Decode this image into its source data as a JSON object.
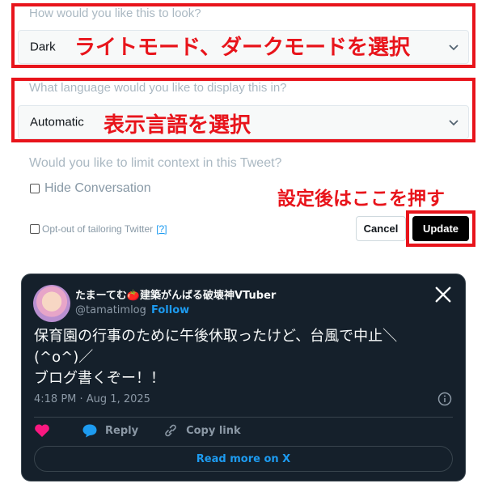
{
  "settings": {
    "look": {
      "label": "How would you like this to look?",
      "value": "Dark",
      "annotation": "ライトモード、ダークモードを選択"
    },
    "language": {
      "label": "What language would you like to display this in?",
      "value": "Automatic",
      "annotation": "表示言語を選択"
    },
    "context": {
      "label": "Would you like to limit context in this Tweet?",
      "hide_conversation": "Hide Conversation"
    },
    "opt_out": {
      "label": "Opt-out of tailoring Twitter",
      "help": "[?]"
    },
    "buttons": {
      "cancel": "Cancel",
      "update": "Update",
      "annotation": "設定後はここを押す"
    }
  },
  "tweet": {
    "author_name": "たまーてむ🍅建築がんばる破壊神VTuber",
    "handle": "@tamatimlog",
    "separator": "·",
    "follow": "Follow",
    "text_lines": [
      "保育園の行事のために午後休取ったけど、台風で中止＼",
      "(^o^)／",
      "ブログ書くぞー！！"
    ],
    "timestamp": "4:18 PM · Aug 1, 2025",
    "reply_label": "Reply",
    "copy_link_label": "Copy link",
    "read_more": "Read more on X"
  },
  "colors": {
    "annotation_red": "#e8141b",
    "tweet_bg": "#15202b",
    "link_blue": "#1d9bf0",
    "like_pink": "#f91880"
  }
}
